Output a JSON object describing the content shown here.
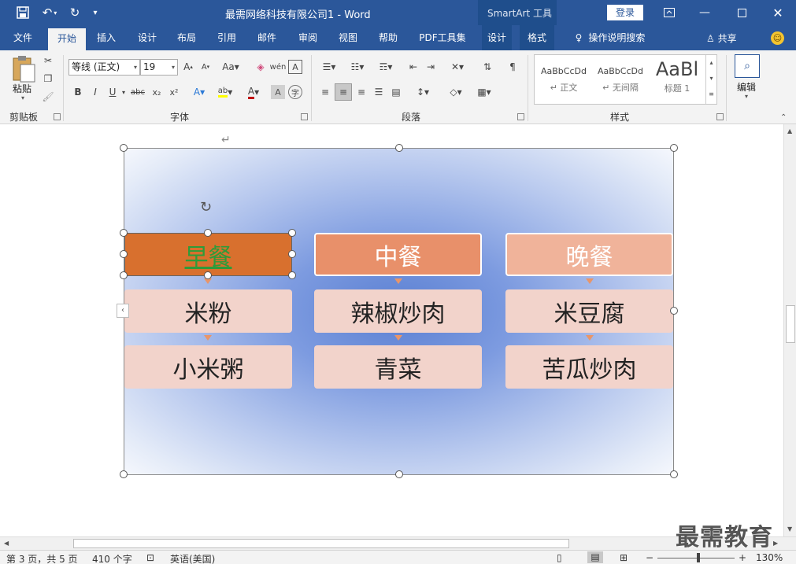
{
  "titlebar": {
    "doc_title": "最需网络科技有限公司1  -  Word",
    "context_tab": "SmartArt 工具",
    "login": "登录"
  },
  "tabs": [
    "文件",
    "开始",
    "插入",
    "设计",
    "布局",
    "引用",
    "邮件",
    "审阅",
    "视图",
    "帮助",
    "PDF工具集",
    "设计",
    "格式"
  ],
  "active_tab": "开始",
  "tell_me": "操作说明搜索",
  "share": "共享",
  "ribbon": {
    "clipboard": {
      "paste": "粘贴",
      "label": "剪贴板"
    },
    "font": {
      "name": "等线 (正文)",
      "size": "19",
      "label": "字体",
      "font_color": "#c00000",
      "highlight_color": "#ffff00"
    },
    "paragraph": {
      "label": "段落"
    },
    "styles": {
      "label": "样式",
      "items": [
        {
          "preview": "AaBbCcDd",
          "name": "↵ 正文"
        },
        {
          "preview": "AaBbCcDd",
          "name": "↵ 无间隔"
        },
        {
          "preview": "AaBl",
          "name": "标题 1"
        }
      ]
    },
    "editing": {
      "label": "编辑"
    }
  },
  "smartart": {
    "columns": [
      {
        "header": "早餐",
        "header_color": "#d8702e",
        "items": [
          "米粉",
          "小米粥"
        ]
      },
      {
        "header": "中餐",
        "header_color": "#e8906a",
        "items": [
          "辣椒炒肉",
          "青菜"
        ]
      },
      {
        "header": "晚餐",
        "header_color": "#f0b39a",
        "items": [
          "米豆腐",
          "苦瓜炒肉"
        ]
      }
    ],
    "item_color": "#f2d3cb",
    "selected_header": "早餐"
  },
  "statusbar": {
    "page": "第 3 页，共 5 页",
    "words": "410 个字",
    "language": "英语(美国)",
    "zoom": "130%"
  },
  "watermark": "最需教育",
  "colors": {
    "brand": "#2b579a",
    "ribbon_bg": "#f3f3f3"
  }
}
